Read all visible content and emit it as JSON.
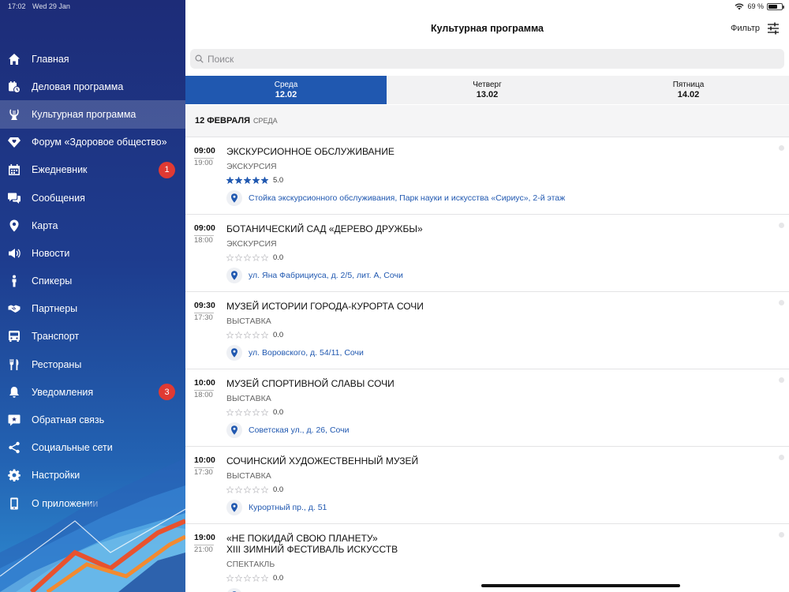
{
  "status_bar": {
    "time": "17:02",
    "date": "Wed 29 Jan",
    "battery": "69 %"
  },
  "menu": [
    {
      "label": "Главная",
      "icon": "home-icon",
      "active": false,
      "badge": ""
    },
    {
      "label": "Деловая программа",
      "icon": "calendar-clock-icon",
      "active": false,
      "badge": ""
    },
    {
      "label": "Культурная программа",
      "icon": "lyre-icon",
      "active": true,
      "badge": ""
    },
    {
      "label": "Форум «Здоровое общество»",
      "icon": "diamond-heart-icon",
      "active": false,
      "badge": ""
    },
    {
      "label": "Ежедневник",
      "icon": "calendar-icon",
      "active": false,
      "badge": "1"
    },
    {
      "label": "Сообщения",
      "icon": "chat-bubbles-icon",
      "active": false,
      "badge": ""
    },
    {
      "label": "Карта",
      "icon": "map-pin-icon",
      "active": false,
      "badge": ""
    },
    {
      "label": "Новости",
      "icon": "megaphone-icon",
      "active": false,
      "badge": ""
    },
    {
      "label": "Спикеры",
      "icon": "speaker-person-icon",
      "active": false,
      "badge": ""
    },
    {
      "label": "Партнеры",
      "icon": "handshake-icon",
      "active": false,
      "badge": ""
    },
    {
      "label": "Транспорт",
      "icon": "bus-icon",
      "active": false,
      "badge": ""
    },
    {
      "label": "Рестораны",
      "icon": "fork-knife-icon",
      "active": false,
      "badge": ""
    },
    {
      "label": "Уведомления",
      "icon": "bell-icon",
      "active": false,
      "badge": "3"
    },
    {
      "label": "Обратная связь",
      "icon": "feedback-icon",
      "active": false,
      "badge": ""
    },
    {
      "label": "Социальные сети",
      "icon": "share-icon",
      "active": false,
      "badge": ""
    },
    {
      "label": "Настройки",
      "icon": "gear-icon",
      "active": false,
      "badge": ""
    },
    {
      "label": "О приложении",
      "icon": "phone-icon",
      "active": false,
      "badge": ""
    }
  ],
  "header": {
    "title": "Культурная программа",
    "filter_label": "Фильтр"
  },
  "search": {
    "placeholder": "Поиск",
    "value": ""
  },
  "day_tabs": [
    {
      "name": "Среда",
      "date": "12.02",
      "active": true
    },
    {
      "name": "Четверг",
      "date": "13.02",
      "active": false
    },
    {
      "name": "Пятница",
      "date": "14.02",
      "active": false
    }
  ],
  "date_header": {
    "date": "12 ФЕВРАЛЯ",
    "weekday": "СРЕДА"
  },
  "events": [
    {
      "start": "09:00",
      "end": "19:00",
      "title_lines": [
        "ЭКСКУРСИОННОЕ ОБСЛУЖИВАНИЕ"
      ],
      "type": "ЭКСКУРСИЯ",
      "rating": "5.0",
      "stars_filled": 5,
      "location": "Стойка экскурсионного обслуживания, Парк науки и искусства «Сириус», 2-й этаж"
    },
    {
      "start": "09:00",
      "end": "18:00",
      "title_lines": [
        "БОТАНИЧЕСКИЙ САД «ДЕРЕВО ДРУЖБЫ»"
      ],
      "type": "ЭКСКУРСИЯ",
      "rating": "0.0",
      "stars_filled": 0,
      "location": "ул. Яна Фабрициуса, д. 2/5, лит. А, Сочи"
    },
    {
      "start": "09:30",
      "end": "17:30",
      "title_lines": [
        "МУЗЕЙ ИСТОРИИ ГОРОДА-КУРОРТА СОЧИ"
      ],
      "type": "ВЫСТАВКА",
      "rating": "0.0",
      "stars_filled": 0,
      "location": "ул. Воровского, д. 54/11, Сочи"
    },
    {
      "start": "10:00",
      "end": "18:00",
      "title_lines": [
        "МУЗЕЙ СПОРТИВНОЙ СЛАВЫ СОЧИ"
      ],
      "type": "ВЫСТАВКА",
      "rating": "0.0",
      "stars_filled": 0,
      "location": "Советская ул., д. 26, Сочи"
    },
    {
      "start": "10:00",
      "end": "17:30",
      "title_lines": [
        "СОЧИНСКИЙ ХУДОЖЕСТВЕННЫЙ МУЗЕЙ"
      ],
      "type": "ВЫСТАВКА",
      "rating": "0.0",
      "stars_filled": 0,
      "location": "Курортный пр., д. 51"
    },
    {
      "start": "19:00",
      "end": "21:00",
      "title_lines": [
        "«НЕ ПОКИДАЙ СВОЮ ПЛАНЕТУ»",
        "XIII ЗИМНИЙ ФЕСТИВАЛЬ ИСКУССТВ"
      ],
      "type": "СПЕКТАКЛЬ",
      "rating": "0.0",
      "stars_filled": 0,
      "location": ""
    }
  ],
  "colors": {
    "accent": "#2058b0",
    "badge": "#e03a33",
    "star_filled": "#2058b0",
    "star_empty": "#c8c8cc"
  }
}
